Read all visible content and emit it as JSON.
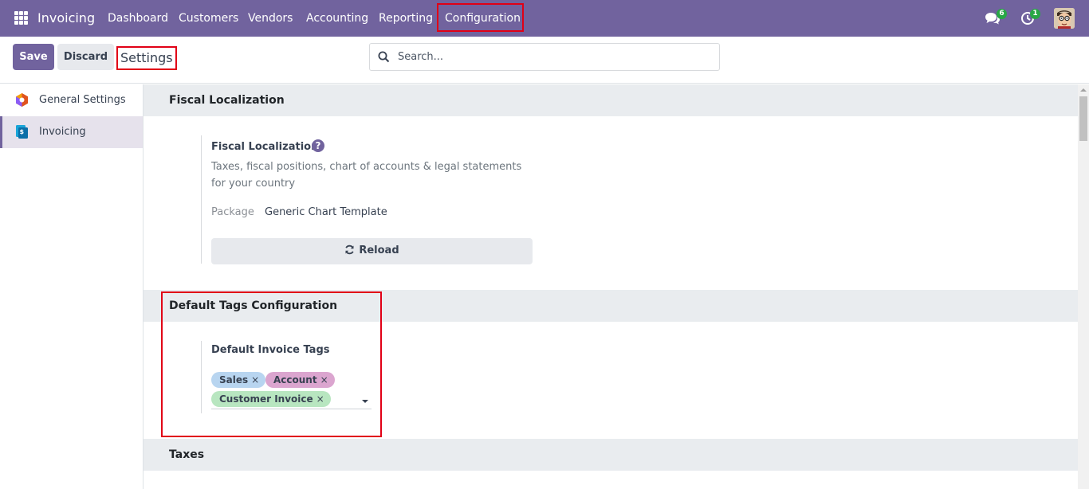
{
  "navbar": {
    "brand": "Invoicing",
    "menu": [
      {
        "label": "Dashboard"
      },
      {
        "label": "Customers"
      },
      {
        "label": "Vendors"
      },
      {
        "label": "Accounting"
      },
      {
        "label": "Reporting"
      },
      {
        "label": "Configuration"
      }
    ],
    "messages_count": "6",
    "activities_count": "1",
    "icons": [
      "apps-grid-icon",
      "chat-icon",
      "clock-icon",
      "user-avatar"
    ],
    "colors": {
      "primary": "#71639e",
      "badge": "#28a745",
      "highlight": "#e10016"
    }
  },
  "control_panel": {
    "save_label": "Save",
    "discard_label": "Discard",
    "title": "Settings",
    "search_placeholder": "Search..."
  },
  "sidebar": {
    "items": [
      {
        "label": "General Settings",
        "icon": "general-settings-icon"
      },
      {
        "label": "Invoicing",
        "icon": "invoicing-app-icon",
        "active": true
      }
    ]
  },
  "sections": {
    "fiscal": {
      "header": "Fiscal Localization",
      "setting_title": "Fiscal Localization",
      "description": "Taxes, fiscal positions, chart of accounts & legal statements for your country",
      "package_label": "Package",
      "package_value": "Generic Chart Template",
      "reload_label": "Reload"
    },
    "tags": {
      "header": "Default Tags Configuration",
      "setting_title": "Default Invoice Tags",
      "tags": [
        {
          "label": "Sales",
          "color": "#b8d5f0"
        },
        {
          "label": "Account",
          "color": "#dba5cf"
        },
        {
          "label": "Customer Invoice",
          "color": "#b8e6c0"
        }
      ]
    },
    "taxes": {
      "header": "Taxes"
    }
  }
}
